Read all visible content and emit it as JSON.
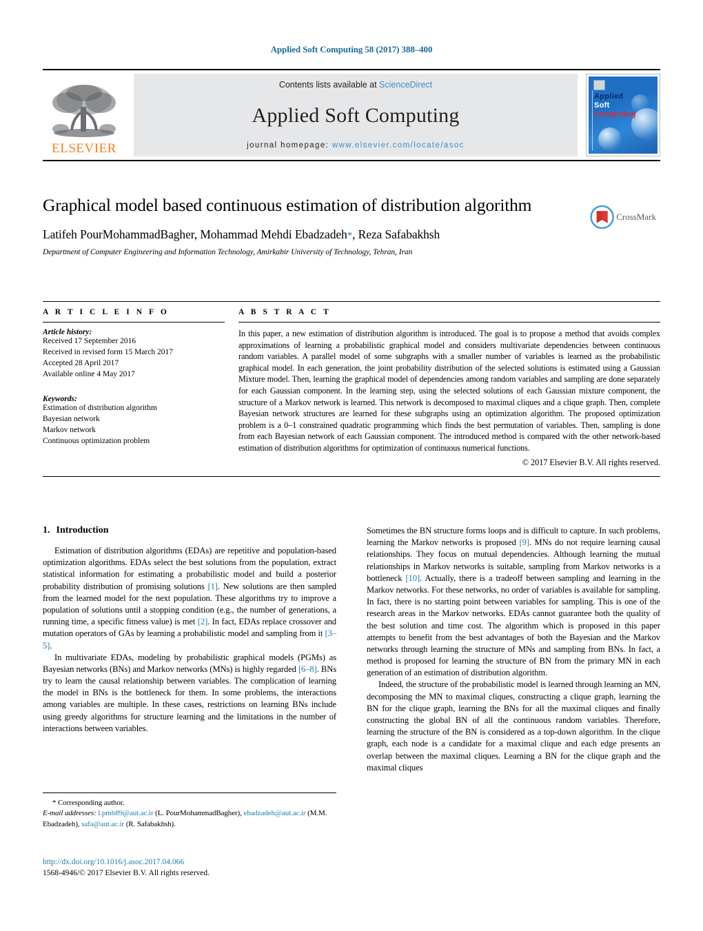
{
  "running_head": "Applied Soft Computing 58 (2017) 388–400",
  "masthead": {
    "contents_prefix": "Contents lists available at ",
    "sciencedirect": "ScienceDirect",
    "journal_name": "Applied Soft Computing",
    "homepage_prefix": "journal homepage: ",
    "homepage_url": "www.elsevier.com/locate/asoc",
    "publisher": "ELSEVIER",
    "cover": {
      "line1": "Applied",
      "line2": "Soft",
      "line3": "Computing"
    },
    "colors": {
      "elsevier_orange": "#F57F20",
      "link_blue": "#3f8dc5",
      "band_gray": "#e6e7e8",
      "cover_blue": "#1f6fc4",
      "cover_red": "#e8262b"
    }
  },
  "title": "Graphical model based continuous estimation of distribution algorithm",
  "authors_pre": "Latifeh PourMohammadBagher, Mohammad Mehdi Ebadzadeh",
  "authors_star": "*",
  "authors_post": ", Reza Safabakhsh",
  "affiliation": "Department of Computer Engineering and Information Technology, Amirkabir University of Technology, Tehran, Iran",
  "crossmark_label": "CrossMark",
  "article_info": {
    "heading": "A R T I C L E  I N F O",
    "history_title": "Article history:",
    "history": [
      "Received 17 September 2016",
      "Received in revised form 15 March 2017",
      "Accepted 28 April 2017",
      "Available online 4 May 2017"
    ],
    "keywords_title": "Keywords:",
    "keywords": [
      "Estimation of distribution algorithm",
      "Bayesian network",
      "Markov network",
      "Continuous optimization problem"
    ]
  },
  "abstract": {
    "heading": "A B S T R A C T",
    "text": "In this paper, a new estimation of distribution algorithm is introduced. The goal is to propose a method that avoids complex approximations of learning a probabilistic graphical model and considers multivariate dependencies between continuous random variables. A parallel model of some subgraphs with a smaller number of variables is learned as the probabilistic graphical model. In each generation, the joint probability distribution of the selected solutions is estimated using a Gaussian Mixture model. Then, learning the graphical model of dependencies among random variables and sampling are done separately for each Gaussian component. In the learning step, using the selected solutions of each Gaussian mixture component, the structure of a Markov network is learned. This network is decomposed to maximal cliques and a clique graph. Then, complete Bayesian network structures are learned for these subgraphs using an optimization algorithm. The proposed optimization problem is a 0–1 constrained quadratic programming which finds the best permutation of variables. Then, sampling is done from each Bayesian network of each Gaussian component. The introduced method is compared with the other network-based estimation of distribution algorithms for optimization of continuous numerical functions.",
    "copyright": "© 2017 Elsevier B.V. All rights reserved."
  },
  "section": {
    "number": "1.",
    "title": "Introduction"
  },
  "body": {
    "left": {
      "p1_a": "Estimation of distribution algorithms (EDAs) are repetitive and population-based optimization algorithms. EDAs select the best solutions from the population, extract statistical information for estimating a probabilistic model and build a posterior probability distribution of promising solutions ",
      "p1_c1": "[1]",
      "p1_b": ". New solutions are then sampled from the learned model for the next population. These algorithms try to improve a population of solutions until a stopping condition (e.g., the number of generations, a running time, a specific fitness value) is met ",
      "p1_c2": "[2]",
      "p1_c": ". In fact, EDAs replace crossover and mutation operators of GAs by learning a probabilistic model and sampling from it ",
      "p1_c3": "[3–5]",
      "p1_d": ".",
      "p2_a": "In multivariate EDAs, modeling by probabilistic graphical models (PGMs) as Bayesian networks (BNs) and Markov networks (MNs) is highly regarded ",
      "p2_c1": "[6–8]",
      "p2_b": ". BNs try to learn the causal relationship between variables. The complication of learning the model in BNs is the bottleneck for them. In some problems, the interactions among variables are multiple. In these cases, restrictions on learning BNs include using greedy algorithms for structure learning and the limitations in the number of interactions between variables."
    },
    "right": {
      "p1_a": "Sometimes the BN structure forms loops and is difficult to capture. In such problems, learning the Markov networks is proposed ",
      "p1_c1": "[9]",
      "p1_b": ". MNs do not require learning causal relationships. They focus on mutual dependencies. Although learning the mutual relationships in Markov networks is suitable, sampling from Markov networks is a bottleneck ",
      "p1_c2": "[10]",
      "p1_c": ". Actually, there is a tradeoff between sampling and learning in the Markov networks. For these networks, no order of variables is available for sampling. In fact, there is no starting point between variables for sampling. This is one of the research areas in the Markov networks. EDAs cannot guarantee both the quality of the best solution and time cost. The algorithm which is proposed in this paper attempts to benefit from the best advantages of both the Bayesian and the Markov networks through learning the structure of MNs and sampling from BNs. In fact, a method is proposed for learning the structure of BN from the primary MN in each generation of an estimation of distribution algorithm.",
      "p2": "Indeed, the structure of the probabilistic model is learned through learning an MN, decomposing the MN to maximal cliques, constructing a clique graph, learning the BN for the clique graph, learning the BNs for all the maximal cliques and finally constructing the global BN of all the continuous random variables. Therefore, learning the structure of the BN is considered as a top-down algorithm. In the clique graph, each node is a candidate for a maximal clique and each edge presents an overlap between the maximal cliques. Learning a BN for the clique graph and the maximal cliques"
    }
  },
  "footnote": {
    "corresponding": "* Corresponding author.",
    "emails_label": "E-mail addresses:",
    "email1": "l.pmb89@aut.ac.ir",
    "email1_name": " (L. PourMohammadBagher),",
    "email2": "ebadzadeh@aut.ac.ir",
    "email2_name": " (M.M. Ebadzadeh),",
    "email3": "safa@aut.ac.ir",
    "email3_name": " (R. Safabakhsh)."
  },
  "colophon": {
    "doi": "http://dx.doi.org/10.1016/j.asoc.2017.04.066",
    "issn": "1568-4946/© 2017 Elsevier B.V. All rights reserved."
  }
}
